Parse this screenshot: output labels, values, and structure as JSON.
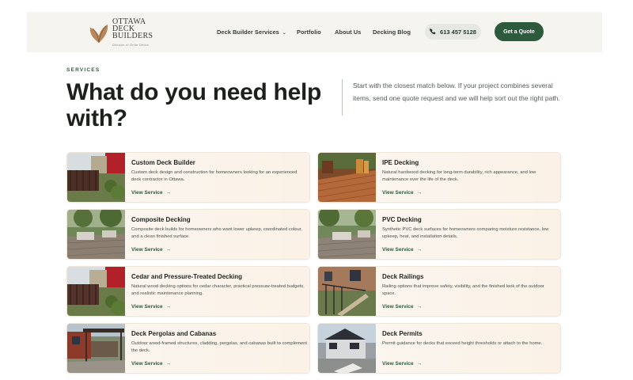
{
  "header": {
    "logo_lines": [
      "OTTAWA",
      "DECK",
      "BUILDERS"
    ],
    "logo_sub": "Division of Onite Decks",
    "nav": {
      "services": "Deck Builder Services",
      "portfolio": "Portfolio",
      "about": "About Us",
      "blog": "Decking Blog"
    },
    "phone": "613 457 5128",
    "cta": "Get a Quote"
  },
  "section": {
    "eyebrow": "SERVICES",
    "headline": "What do you need help with?",
    "intro": "Start with the closest match below. If your project combines several items, send one quote request and we will help sort out the right path."
  },
  "cards": [
    {
      "title": "Custom Deck Builder",
      "desc": "Custom deck design and construction for homeowners looking for an experienced deck contractor in Ottawa.",
      "link": "View Service",
      "image": "deck-with-house-photo"
    },
    {
      "title": "IPE Decking",
      "desc": "Natural hardwood decking for long-term durability, rich appearance, and low maintenance over the life of the deck.",
      "link": "View Service",
      "image": "hardwood-deck-photo"
    },
    {
      "title": "Composite Decking",
      "desc": "Composite deck builds for homeowners who want lower upkeep, coordinated colour, and a clean finished surface.",
      "link": "View Service",
      "image": "composite-deck-photo"
    },
    {
      "title": "PVC Decking",
      "desc": "Synthetic PVC deck surfaces for homeowners comparing moisture resistance, low upkeep, heat, and installation details.",
      "link": "View Service",
      "image": "pvc-deck-photo"
    },
    {
      "title": "Cedar and Pressure-Treated Decking",
      "desc": "Natural wood decking options for cedar character, practical pressure-treated budgets, and realistic maintenance planning.",
      "link": "View Service",
      "image": "cedar-deck-photo"
    },
    {
      "title": "Deck Railings",
      "desc": "Railing options that improve safety, visibility, and the finished look of the outdoor space.",
      "link": "View Service",
      "image": "railing-stairs-photo"
    },
    {
      "title": "Deck Pergolas and Cabanas",
      "desc": "Outdoor wood-framed structures, cladding, pergolas, and cabanas built to complement the deck.",
      "link": "View Service",
      "image": "pergola-photo"
    },
    {
      "title": "Deck Permits",
      "desc": "Permit guidance for decks that exceed height thresholds or attach to the home.",
      "link": "View Service",
      "image": "house-permit-photo"
    }
  ],
  "colors": {
    "brand_green": "#2d5a3d",
    "header_bg": "#f6f4ef",
    "card_bg": "#fbf3ea"
  }
}
